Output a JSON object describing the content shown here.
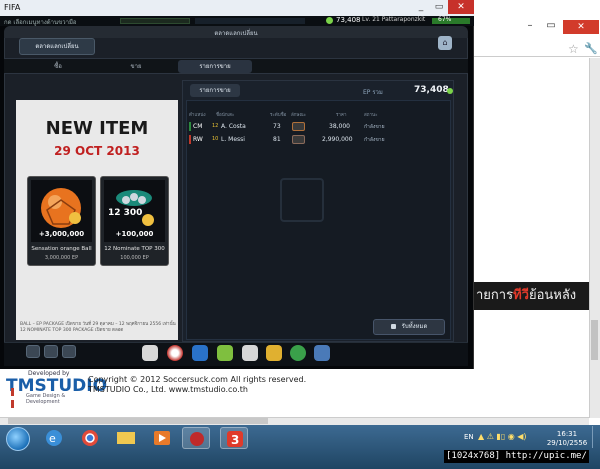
{
  "window": {
    "title": "FIFA",
    "controls": [
      "_",
      "▭",
      "✕"
    ]
  },
  "status": {
    "breadcrumb": "กด เลือกเมนูทางด้านขวามือ",
    "cash": "73,408",
    "level": "Lv. 21 Pattaraponzkit",
    "exp": "67%"
  },
  "panel": {
    "title": "ตลาดแลกเปลี่ยน",
    "main_tab": "ตลาดแลกเปลี่ยน",
    "subtabs": [
      "ซื้อ",
      "ขาย",
      "รายการขาย"
    ]
  },
  "promo": {
    "title": "NEW ITEM",
    "date": "29 OCT 2013",
    "cards": [
      {
        "name": "Sensation orange Ball",
        "price": "3,000,000 EP",
        "art_text": "+3,000,000"
      },
      {
        "name": "12 Nominate TOP 300",
        "price": "100,000 EP",
        "art_text": "+100,000",
        "badge": "12 300"
      }
    ],
    "fine_print": "BALL – EP PACKAGE เปิดขาย วันที่ 29 ตุลาคม – 12 พฤศจิกายน 2556 เท่านั้น\n12 NOMINATE TOP 300 PACKAGE เปิดขาย ตลอด"
  },
  "sales": {
    "tab": "รายการขาย",
    "ep_label": "EP รวม",
    "ep_value": "73,408",
    "columns": [
      "ตำแหน่ง",
      "ชื่อนักเตะ",
      "ระดับชื่อ",
      "ลักษณะ",
      "ราคา",
      "สถานะ"
    ],
    "rows": [
      {
        "pos": "CM",
        "pos_color": "#2b8a3e",
        "num": "12",
        "name": "A. Costa",
        "ovr": "73",
        "price": "38,000",
        "status": "กำลังขาย"
      },
      {
        "pos": "RW",
        "pos_color": "#c0392b",
        "num": "10",
        "name": "L. Messi",
        "ovr": "81",
        "price": "2,990,000",
        "status": "กำลังขาย"
      }
    ],
    "collect_button": "รับทั้งหมด"
  },
  "toolbar_icons": [
    "boots-icon",
    "ball-icon",
    "shoe-icon",
    "cone-icon",
    "gold-boot-icon",
    "trophy-icon",
    "badge-icon",
    "basket-icon"
  ],
  "banner": {
    "text_before": "ายการ",
    "highlight": "ทีวี",
    "text_after": "ย้อนหลัง"
  },
  "footer": {
    "developed_by": "Developed by",
    "logo": "TMSTUDIO",
    "logo_sub": "Game Design & Development",
    "copyright": "Copyright © 2012 Soccersuck.com All rights reserved.",
    "company": "TMSTUDIO Co., Ltd. www.tmstudio.co.th"
  },
  "taskbar": {
    "language": "EN",
    "time": "16:31",
    "date": "29/10/2556"
  },
  "watermark": "[1024x768] http://upic.me/"
}
